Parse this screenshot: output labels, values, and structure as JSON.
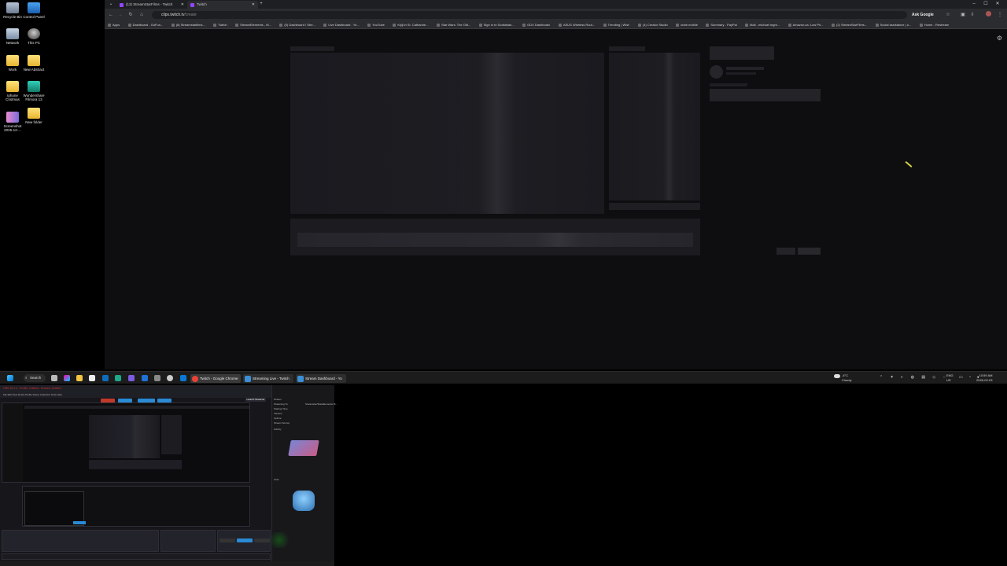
{
  "desktop": {
    "icons": [
      {
        "label": "Recycle Bin"
      },
      {
        "label": "Control Panel"
      },
      {
        "label": "Network"
      },
      {
        "label": "This PC"
      },
      {
        "label": "Work"
      },
      {
        "label": "New Abstract"
      },
      {
        "label": "Iphone Cristmas"
      },
      {
        "label": "Wondershare Filmora 13"
      },
      {
        "label": "Screenshot 2025-12-..."
      },
      {
        "label": "New folder"
      }
    ]
  },
  "browser": {
    "tabs": [
      {
        "label": "(12) StreamStarFilms - Twitch",
        "active": false
      },
      {
        "label": "Twitch",
        "active": true
      }
    ],
    "new_tab": "+",
    "window_controls": {
      "minimize": "–",
      "maximize": "☐",
      "close": "✕"
    },
    "address": {
      "host": "clips.twitch.tv",
      "path": "/create"
    },
    "ask_google": "Ask Google",
    "bookmarks": [
      "Apps",
      "Dashboard - GoFun...",
      "(8) Streamstarfilms...",
      "Twitch",
      "StreamElements - M...",
      "(5) Dashboard / Stre...",
      "Live Dashboard - Yo...",
      "YouTube",
      "Kijiji in St. Catharine...",
      "Star Wars: The Old...",
      "Sign in to Scotiaban...",
      "GDX Dashboard",
      "ASUS Wireless Rout...",
      "Trending | Wish",
      "(4) Creator Studio",
      "chatr mobile",
      "Summary - PayPal",
      "Mail - michael mgm...",
      "Amazon.ca: Low Pri...",
      "(2) StreamStarFilms...",
      "Social assistance | o...",
      "Home - Restream"
    ]
  },
  "taskbar": {
    "search": "Search",
    "windows": [
      {
        "label": "Twitch - Google Chrome",
        "color": "#e94235"
      },
      {
        "label": "Streaming Live - Twitch",
        "color": "#3a8fd6"
      },
      {
        "label": "Stream Dashboard - Yo",
        "color": "#3a8fd6"
      }
    ],
    "weather": {
      "temp": "-4°C",
      "cond": "Cloudy"
    },
    "lang": {
      "lang": "ENG",
      "region": "US"
    },
    "clock": {
      "time": "10:59 AM",
      "date": "2026-02-03"
    }
  },
  "obs": {
    "title": "OBS 32.0.4 - Profile: Untitled - Scenes: Untitled",
    "buttons": {
      "red": "",
      "blue1": "",
      "blue2": "",
      "blue3": "",
      "right": "Launch Streamer"
    },
    "right_panel": {
      "labels": [
        "Stream",
        "Streaming To",
        "Starting Time",
        "Viewers",
        "Uptime",
        "Stream Source"
      ],
      "section1": "Activity",
      "section2": "Chat",
      "stream_to": "Streamstar/StarsElements M..."
    }
  },
  "colors": {
    "accent": "#9146ff",
    "obs_red": "#c0392b",
    "obs_blue": "#2a8ad4"
  }
}
